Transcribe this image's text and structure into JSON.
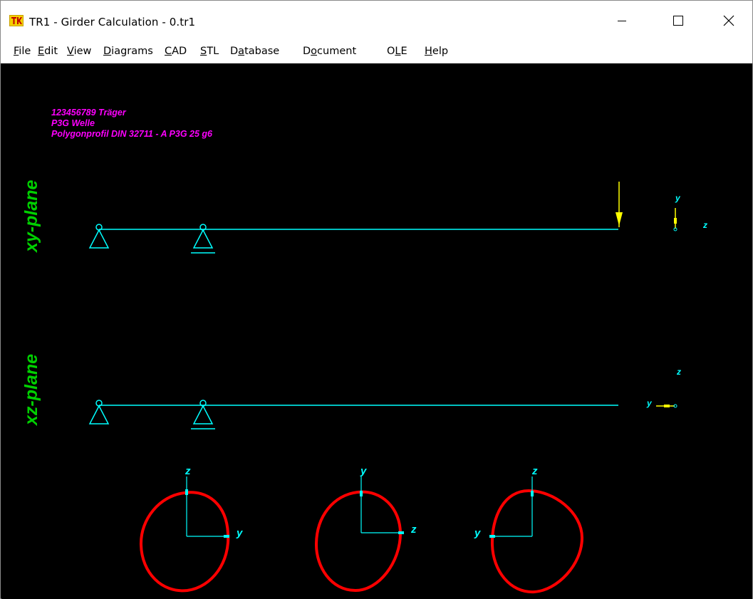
{
  "window": {
    "title": "TR1  -  Girder Calculation  -  0.tr1",
    "icon": "tr1-app-icon",
    "controls": {
      "minimize": "minimize-icon",
      "maximize": "maximize-icon",
      "close": "close-icon"
    }
  },
  "menu": [
    {
      "pre": "",
      "acc": "F",
      "post": "ile"
    },
    {
      "pre": "",
      "acc": "E",
      "post": "dit"
    },
    {
      "pre": "",
      "acc": "V",
      "post": "iew"
    },
    {
      "pre": "",
      "acc": "D",
      "post": "iagrams"
    },
    {
      "pre": "",
      "acc": "C",
      "post": "AD"
    },
    {
      "pre": "",
      "acc": "S",
      "post": "TL"
    },
    {
      "pre": "D",
      "acc": "a",
      "post": "tabase"
    },
    {
      "pre": "D",
      "acc": "o",
      "post": "cument"
    },
    {
      "pre": "O",
      "acc": "L",
      "post": "E"
    },
    {
      "pre": "",
      "acc": "H",
      "post": "elp"
    }
  ],
  "info": {
    "line1": "123456789  Träger",
    "line2": "P3G Welle",
    "line3": "Polygonprofil DIN 32711 - A P3G 25 g6"
  },
  "planes": {
    "xy": "xy-plane",
    "xz": "xz-plane"
  },
  "axes": {
    "y": "y",
    "z": "z"
  },
  "colors": {
    "beam": "#00ffff",
    "load": "#ffff00",
    "label": "#00d000",
    "info": "#ff00ff",
    "profile": "#ff0000"
  }
}
